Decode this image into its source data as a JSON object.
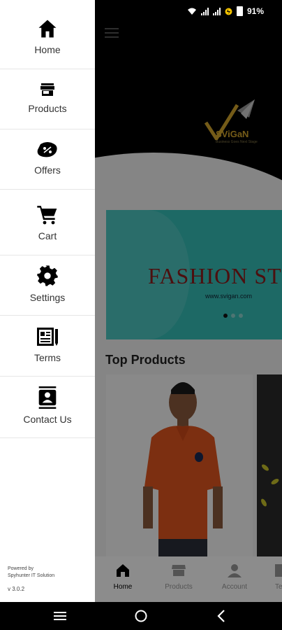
{
  "status_bar": {
    "battery": "91%"
  },
  "drawer": {
    "items": [
      {
        "label": "Home",
        "icon": "home-icon"
      },
      {
        "label": "Products",
        "icon": "store-icon"
      },
      {
        "label": "Offers",
        "icon": "discount-tag-icon"
      },
      {
        "label": "Cart",
        "icon": "cart-icon"
      },
      {
        "label": "Settings",
        "icon": "gear-icon"
      },
      {
        "label": "Terms",
        "icon": "document-icon"
      },
      {
        "label": "Contact Us",
        "icon": "contact-card-icon"
      }
    ],
    "powered_by_line1": "Powered by",
    "powered_by_line2": "Spyhunter IT Solution",
    "version": "v 3.0.2"
  },
  "app": {
    "logo_text": "SViGaN",
    "logo_tagline": "Business Goes Next Stage",
    "banner": {
      "title": "FASHION STO",
      "url": "www.svigan.com",
      "dots": 3,
      "active_dot": 0
    },
    "section_title": "Top Products",
    "bottom_nav": [
      {
        "label": "Home",
        "icon": "home-icon",
        "active": true
      },
      {
        "label": "Products",
        "icon": "store-icon",
        "active": false
      },
      {
        "label": "Account",
        "icon": "person-icon",
        "active": false
      },
      {
        "label": "Ter",
        "icon": "document-icon",
        "active": false
      }
    ]
  },
  "colors": {
    "banner_bg": "#35c0b9",
    "banner_title": "#8a1d1d",
    "logo_gold": "#d4a72c",
    "header_bg": "#000000"
  }
}
